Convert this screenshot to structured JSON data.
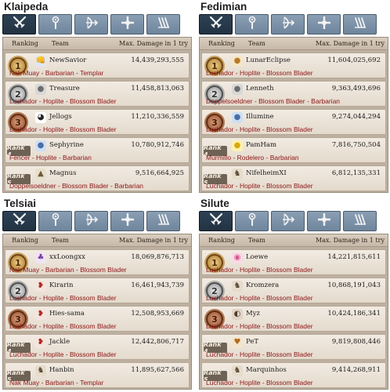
{
  "colors": {
    "class_text": "#8d1515",
    "tab_active": "#2e4256",
    "tab_inactive": "#7e93a8",
    "board_bg": "#bdb0a1",
    "row_bg": "#efe7dd"
  },
  "panels": [
    {
      "server": "Klaipeda",
      "headers": {
        "ranking": "Ranking",
        "team": "Team",
        "damage": "Max. Damage in 1 try"
      },
      "rows": [
        {
          "medal": "gold",
          "rank": "1",
          "team": "NewSavior",
          "damage": "14,439,293,555",
          "classes": "Nak Muay - Barbarian - Templar",
          "avatar_icon": "fighter-icon"
        },
        {
          "medal": "silver",
          "rank": "2",
          "team": "Treasure",
          "damage": "11,458,813,063",
          "classes": "Luchador - Hoplite - Blossom Blader",
          "avatar_icon": "coin-icon"
        },
        {
          "medal": "bronze",
          "rank": "3",
          "team": "Jellogs",
          "damage": "11,210,336,559",
          "classes": "Luchador - Hoplite - Blossom Blader",
          "avatar_icon": "sunglasses-icon"
        },
        {
          "medal": "plate",
          "rank": "Rank 4",
          "team": "Sephyrine",
          "damage": "10,780,912,746",
          "classes": "Fencer - Hoplite - Barbarian",
          "avatar_icon": "blue-creature-icon"
        },
        {
          "medal": "plate",
          "rank": "Rank 5",
          "team": "Magnus",
          "damage": "9,516,664,925",
          "classes": "Doppelsoeldner - Blossom Blader - Barbarian",
          "avatar_icon": "bird-icon"
        }
      ]
    },
    {
      "server": "Fedimian",
      "headers": {
        "ranking": "Ranking",
        "team": "Team",
        "damage": "Max. Damage in 1 try"
      },
      "rows": [
        {
          "medal": "gold",
          "rank": "1",
          "team": "LunarEclipse",
          "damage": "11,604,025,692",
          "classes": "Luchador - Hoplite - Blossom Blader",
          "avatar_icon": "hamster-icon"
        },
        {
          "medal": "silver",
          "rank": "2",
          "team": "Lenneth",
          "damage": "9,363,493,696",
          "classes": "Doppelsoeldner - Blossom Blader - Barbarian",
          "avatar_icon": "coin-icon"
        },
        {
          "medal": "bronze",
          "rank": "3",
          "team": "Illumine",
          "damage": "9,274,044,294",
          "classes": "Luchador - Hoplite - Blossom Blader",
          "avatar_icon": "blue-creature-icon"
        },
        {
          "medal": "plate",
          "rank": "Rank 4",
          "team": "PamHam",
          "damage": "7,816,750,504",
          "classes": "Murmillo - Rodelero - Barbarian",
          "avatar_icon": "chick-icon"
        },
        {
          "medal": "plate",
          "rank": "Rank 5",
          "team": "NifelheimXI",
          "damage": "6,812,135,331",
          "classes": "Luchador - Hoplite - Blossom Blader",
          "avatar_icon": "knight-icon"
        }
      ]
    },
    {
      "server": "Telsiai",
      "headers": {
        "ranking": "Ranking",
        "team": "Team",
        "damage": "Max. Damage in 1 try"
      },
      "rows": [
        {
          "medal": "gold",
          "rank": "1",
          "team": "xxLoongxx",
          "damage": "18,069,876,713",
          "classes": "Nak Muay - Barbarian - Blossom Blader",
          "avatar_icon": "purple-creature-icon"
        },
        {
          "medal": "silver",
          "rank": "2",
          "team": "Kirarin",
          "damage": "16,461,943,739",
          "classes": "Luchador - Hoplite - Blossom Blader",
          "avatar_icon": "red-bird-icon"
        },
        {
          "medal": "bronze",
          "rank": "3",
          "team": "Hies-sama",
          "damage": "12,508,953,669",
          "classes": "Luchador - Hoplite - Blossom Blader",
          "avatar_icon": "red-bird-icon"
        },
        {
          "medal": "plate",
          "rank": "Rank 4",
          "team": "Jackle",
          "damage": "12,442,806,717",
          "classes": "Luchador - Hoplite - Blossom Blader",
          "avatar_icon": "red-bird-icon"
        },
        {
          "medal": "plate",
          "rank": "Rank 5",
          "team": "Hanbin",
          "damage": "11,895,627,566",
          "classes": "Nak Muay - Barbarian - Templar",
          "avatar_icon": "knight-icon"
        }
      ]
    },
    {
      "server": "Silute",
      "headers": {
        "ranking": "Ranking",
        "team": "Team",
        "damage": "Max. Damage in 1 try"
      },
      "rows": [
        {
          "medal": "gold",
          "rank": "1",
          "team": "Loewe",
          "damage": "14,221,815,611",
          "classes": "Luchador - Hoplite - Blossom Blader",
          "avatar_icon": "pink-pig-icon"
        },
        {
          "medal": "silver",
          "rank": "2",
          "team": "Kromzera",
          "damage": "10,868,191,043",
          "classes": "Luchador - Hoplite - Blossom Blader",
          "avatar_icon": "knight-icon"
        },
        {
          "medal": "bronze",
          "rank": "3",
          "team": "Myz",
          "damage": "10,424,186,341",
          "classes": "Luchador - Hoplite - Blossom Blader",
          "avatar_icon": "portrait-icon"
        },
        {
          "medal": "plate",
          "rank": "Rank 4",
          "team": "PeT",
          "damage": "9,819,808,446",
          "classes": "Luchador - Hoplite - Blossom Blader",
          "avatar_icon": "pet-icon"
        },
        {
          "medal": "plate",
          "rank": "Rank 5",
          "team": "Marquinhos",
          "damage": "9,414,268,911",
          "classes": "Luchador - Hoplite - Blossom Blader",
          "avatar_icon": "knight-icon"
        }
      ]
    }
  ],
  "tab_icons": [
    "swords-icon",
    "staff-icon",
    "bow-icon",
    "cross-icon",
    "scripture-icon"
  ]
}
